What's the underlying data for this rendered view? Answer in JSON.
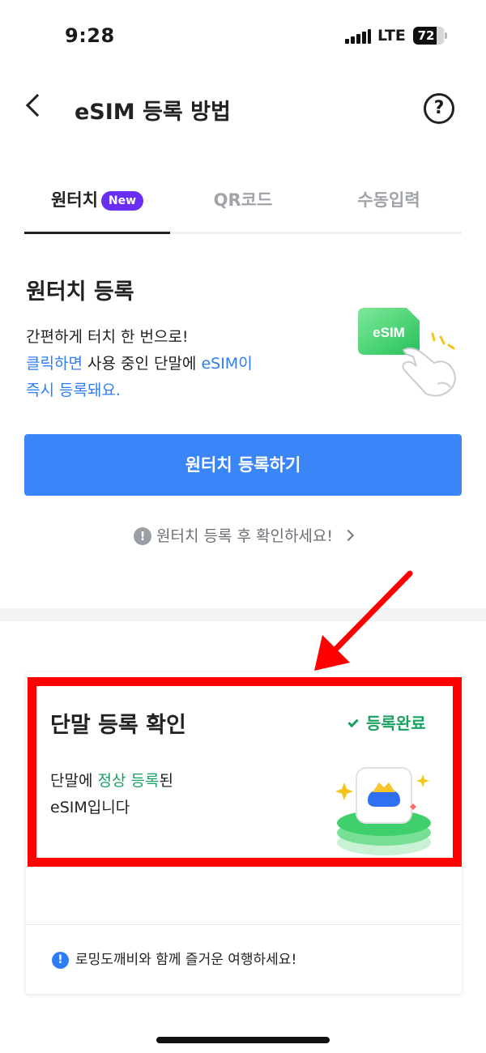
{
  "status_bar": {
    "time": "9:28",
    "network": "LTE",
    "battery": "72"
  },
  "header": {
    "title": "eSIM 등록 방법",
    "help_icon": "question-circle-icon",
    "back_icon": "chevron-left-icon"
  },
  "tabs": [
    {
      "label": "원터치",
      "badge": "New",
      "active": true
    },
    {
      "label": "QR코드",
      "active": false
    },
    {
      "label": "수동입력",
      "active": false
    }
  ],
  "one_touch": {
    "title": "원터치 등록",
    "line1": "간편하게 터치 한 번으로!",
    "line2_blue_a": "클릭하면",
    "line2_plain": " 사용 중인 단말에 ",
    "line2_blue_b": "eSIM이",
    "line3_blue": "즉시 등록돼요.",
    "illustration_label": "eSIM",
    "button_label": "원터치 등록하기",
    "notice": "원터치 등록 후 확인하세요!",
    "notice_icon": "!"
  },
  "device_check": {
    "title": "단말 등록 확인",
    "status": "등록완료",
    "desc_a": "단말에 ",
    "desc_green": "정상 등록",
    "desc_b": "된",
    "desc_line2": "eSIM입니다",
    "footer": "로밍도깨비와 함께 즐거운 여행하세요!",
    "footer_icon": "!"
  },
  "colors": {
    "accent_blue": "#3a85f7",
    "new_badge": "#6a2df2",
    "success_green": "#1aa260",
    "highlight_red": "#ff0000"
  }
}
